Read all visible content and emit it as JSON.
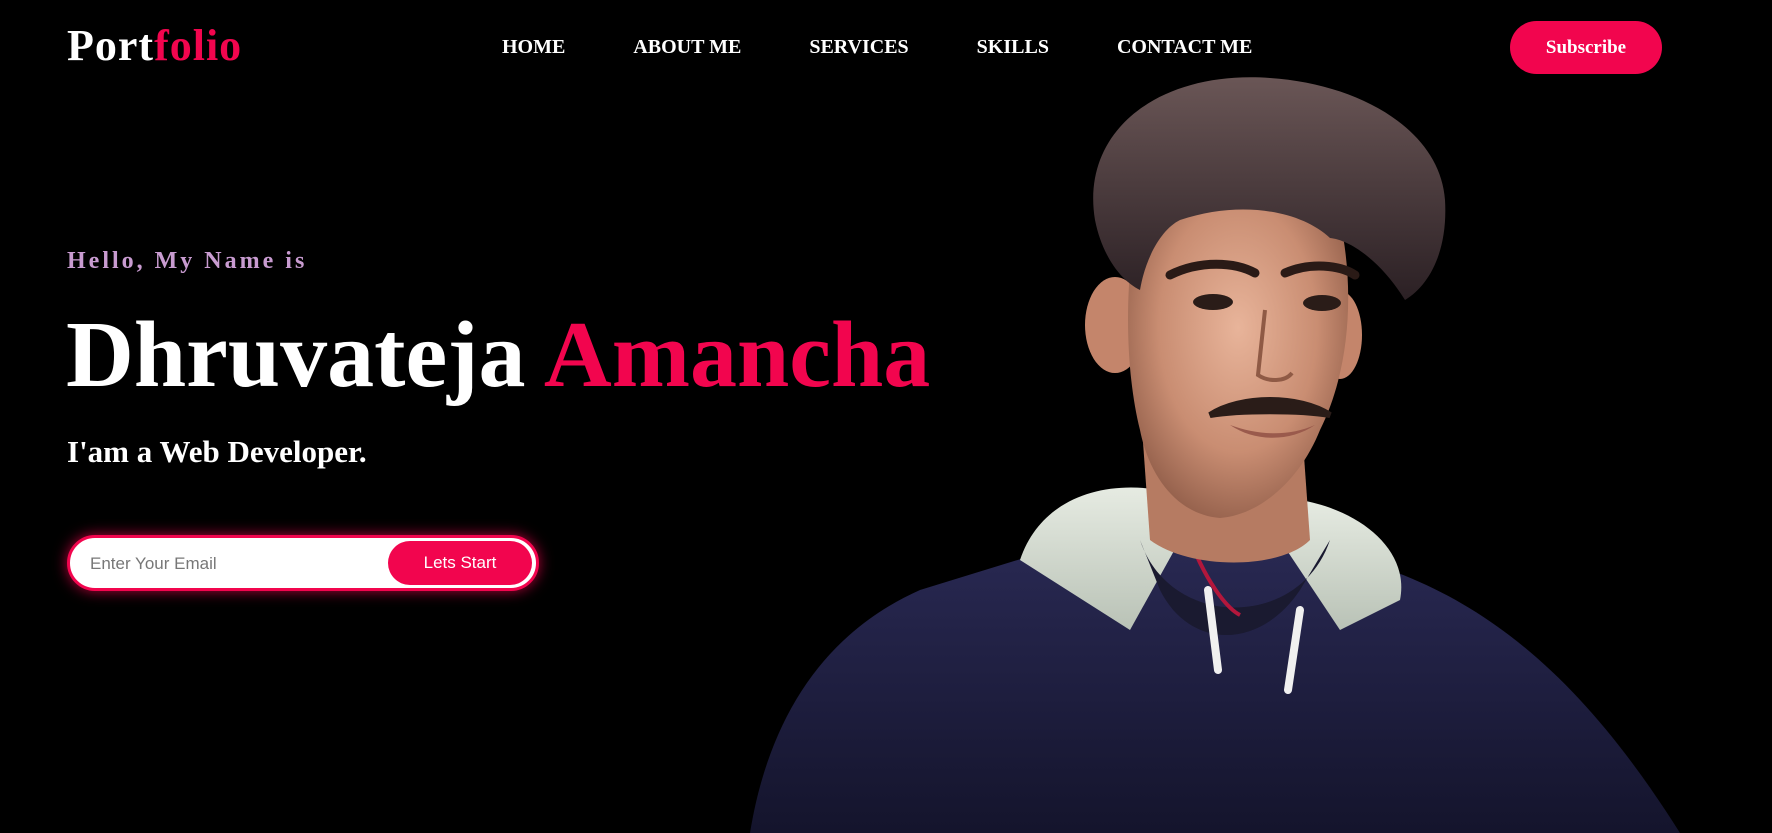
{
  "logo": {
    "part1": "Port",
    "part2": "folio"
  },
  "nav": {
    "items": [
      {
        "label": "HOME"
      },
      {
        "label": "ABOUT ME"
      },
      {
        "label": "SERVICES"
      },
      {
        "label": "SKILLS"
      },
      {
        "label": "CONTACT ME"
      }
    ],
    "subscribe_label": "Subscribe"
  },
  "hero": {
    "greeting": "Hello, My Name is",
    "first_name": "Dhruvateja",
    "last_name": "Amancha",
    "role": "I'am a Web Developer.",
    "email_placeholder": "Enter Your Email",
    "email_value": "",
    "start_label": "Lets Start"
  },
  "colors": {
    "accent": "#f2054e",
    "background": "#000000",
    "greeting": "#c89bd0",
    "text": "#ffffff"
  },
  "icons": {
    "portrait": "profile-photo"
  }
}
